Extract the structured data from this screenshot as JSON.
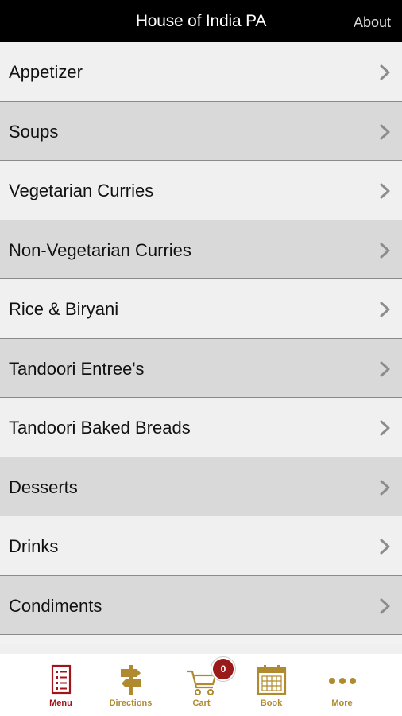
{
  "header": {
    "title": "House of India PA",
    "about_label": "About"
  },
  "menu": {
    "items": [
      {
        "label": "Appetizer"
      },
      {
        "label": "Soups"
      },
      {
        "label": "Vegetarian Curries"
      },
      {
        "label": "Non-Vegetarian Curries"
      },
      {
        "label": "Rice & Biryani"
      },
      {
        "label": "Tandoori Entree's"
      },
      {
        "label": "Tandoori Baked Breads"
      },
      {
        "label": "Desserts"
      },
      {
        "label": "Drinks"
      },
      {
        "label": "Condiments"
      }
    ]
  },
  "tabbar": {
    "tabs": [
      {
        "label": "Menu",
        "icon": "menu-list-icon",
        "active": true
      },
      {
        "label": "Directions",
        "icon": "signpost-icon",
        "active": false
      },
      {
        "label": "Cart",
        "icon": "cart-icon",
        "active": false
      },
      {
        "label": "Book",
        "icon": "calendar-icon",
        "active": false
      },
      {
        "label": "More",
        "icon": "more-dots-icon",
        "active": false
      }
    ],
    "cart_count": "0"
  },
  "colors": {
    "header_bg": "#000000",
    "row_light": "#f0f0f0",
    "row_dark": "#d9d9d9",
    "tab_gold": "#b08a2e",
    "tab_active": "#a0151c",
    "badge": "#9a1a1a"
  }
}
